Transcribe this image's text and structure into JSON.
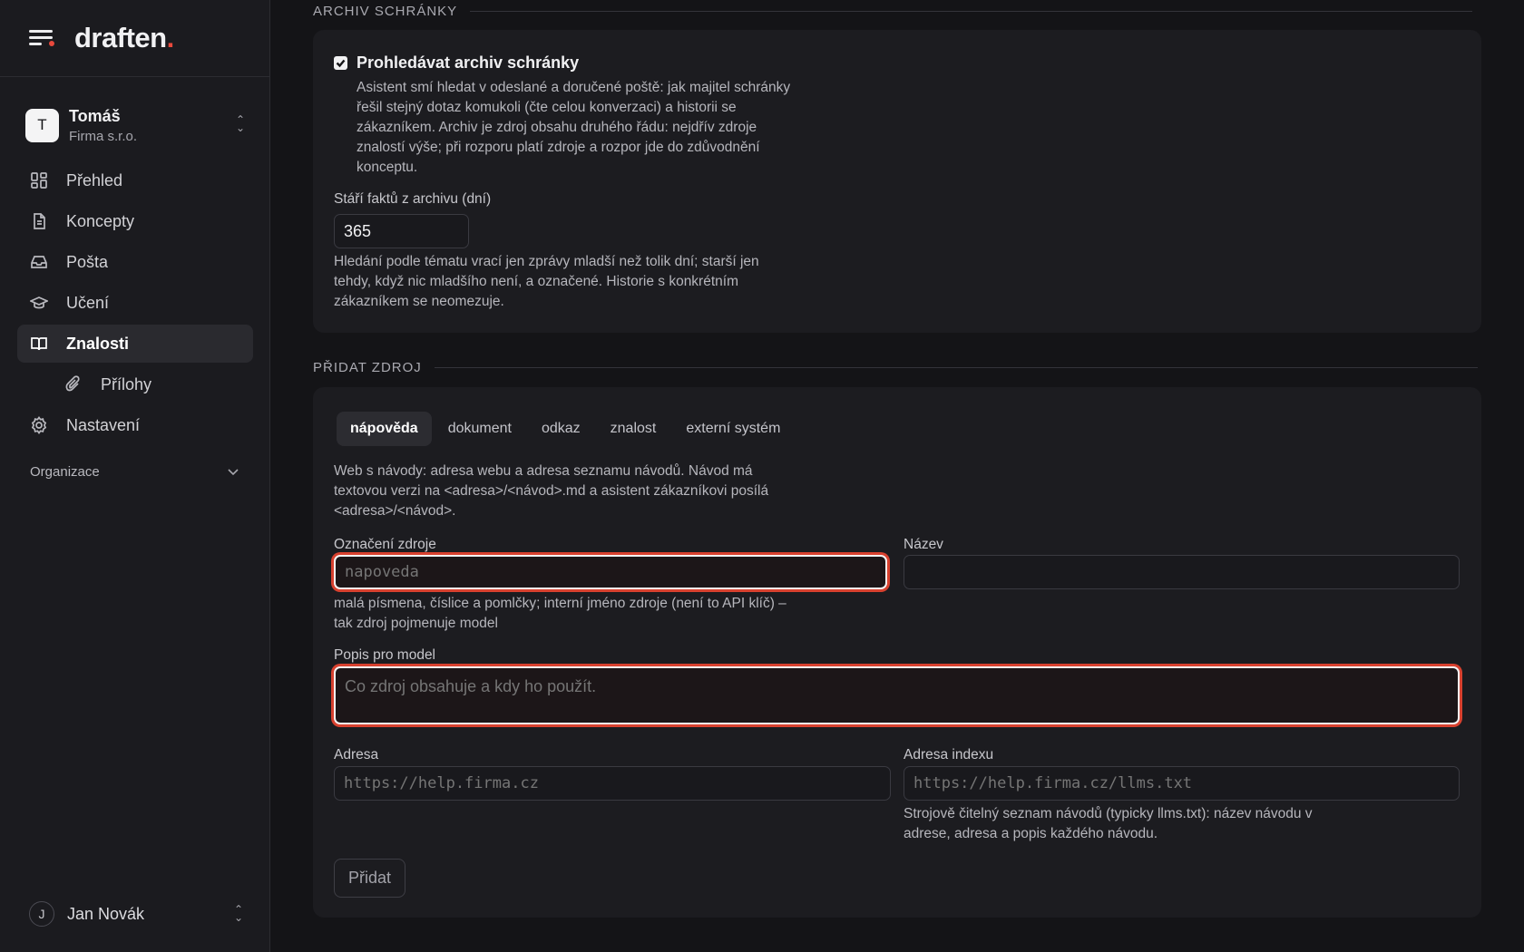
{
  "brand": {
    "name": "draften",
    "period": "."
  },
  "org": {
    "avatar_letter": "T",
    "name": "Tomáš",
    "company": "Firma s.r.o."
  },
  "nav": {
    "items": [
      {
        "label": "Přehled",
        "icon": "dashboard-icon"
      },
      {
        "label": "Koncepty",
        "icon": "document-icon"
      },
      {
        "label": "Pošta",
        "icon": "inbox-icon"
      },
      {
        "label": "Učení",
        "icon": "graduation-cap-icon"
      },
      {
        "label": "Znalosti",
        "icon": "book-icon",
        "active": true
      },
      {
        "label": "Přílohy",
        "icon": "paperclip-icon",
        "sub": true
      },
      {
        "label": "Nastavení",
        "icon": "gear-icon"
      }
    ],
    "section": "Organizace"
  },
  "user": {
    "avatar_letter": "J",
    "name": "Jan Novák"
  },
  "archive": {
    "section_title": "ARCHIV SCHRÁNKY",
    "checkbox_label": "Prohledávat archiv schránky",
    "checkbox_checked": true,
    "description": [
      "Asistent smí hledat v odeslané a doručené poště: jak majitel schránky",
      "řešil stejný dotaz komukoli (čte celou konverzaci) a historii se",
      "zákazníkem. Archiv je zdroj obsahu druhého řádu: nejdřív zdroje",
      "znalostí výše; při rozporu platí zdroje a rozpor jde do zdůvodnění",
      "konceptu."
    ],
    "age_label": "Stáří faktů z archivu (dní)",
    "age_value": "365",
    "age_help": [
      "Hledání podle tématu vrací jen zprávy mladší než tolik dní; starší jen",
      "tehdy, když nic mladšího není, a označené. Historie s konkrétním",
      "zákazníkem se neomezuje."
    ]
  },
  "add_source": {
    "section_title": "PŘIDAT ZDROJ",
    "tabs": [
      "nápověda",
      "dokument",
      "odkaz",
      "znalost",
      "externí systém"
    ],
    "active_tab": "nápověda",
    "intro": [
      "Web s návody: adresa webu a adresa seznamu návodů. Návod má",
      "textovou verzi na <adresa>/<návod>.md a asistent zákazníkovi posílá",
      "<adresa>/<návod>."
    ],
    "slug_label": "Označení zdroje",
    "slug_placeholder": "napoveda",
    "slug_help": [
      "malá písmena, číslice a pomlčky; interní jméno zdroje (není to API klíč) –",
      "tak zdroj pojmenuje model"
    ],
    "name_label": "Název",
    "name_value": "",
    "desc_label": "Popis pro model",
    "desc_placeholder": "Co zdroj obsahuje a kdy ho použít.",
    "address_label": "Adresa",
    "address_placeholder": "https://help.firma.cz",
    "index_label": "Adresa indexu",
    "index_placeholder": "https://help.firma.cz/llms.txt",
    "index_help": [
      "Strojově čitelný seznam návodů (typicky llms.txt): název návodu v",
      "adrese, adresa a popis každého návodu."
    ],
    "submit_label": "Přidat"
  },
  "colors": {
    "accent": "#e9493c",
    "error_ring": "#d8412f",
    "background": "#141417",
    "card": "#1c1c20"
  }
}
